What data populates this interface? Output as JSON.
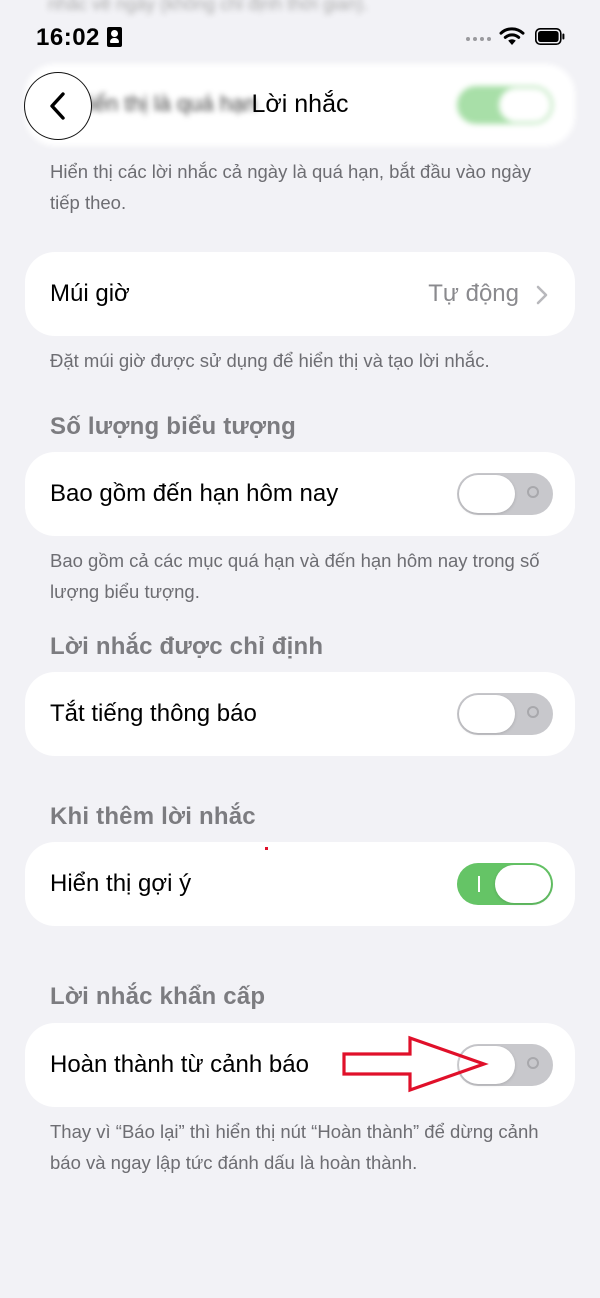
{
  "status_bar": {
    "time": "16:02"
  },
  "nav": {
    "title": "Lời nhắc",
    "back_icon": "chevron-left-icon"
  },
  "scrolled": {
    "top_text": "nhắc về ngày (không chỉ định thời gian).",
    "row_label": "Hiển thị là quá hạn"
  },
  "overdue_footnote": "Hiển thị các lời nhắc cả ngày là quá hạn, bắt đầu vào ngày tiếp theo.",
  "timezone": {
    "label": "Múi giờ",
    "value": "Tự động",
    "footnote": "Đặt múi giờ được sử dụng để hiển thị và tạo lời nhắc."
  },
  "badge_count": {
    "header": "Số lượng biểu tượng",
    "row_label": "Bao gồm đến hạn hôm nay",
    "enabled": false,
    "footnote": "Bao gồm cả các mục quá hạn và đến hạn hôm nay trong số lượng biểu tượng."
  },
  "assigned": {
    "header": "Lời nhắc được chỉ định",
    "row_label": "Tắt tiếng thông báo",
    "enabled": false
  },
  "when_adding": {
    "header": "Khi thêm lời nhắc",
    "row_label": "Hiển thị gợi ý",
    "enabled": true
  },
  "urgent": {
    "header": "Lời nhắc khẩn cấp",
    "row_label": "Hoàn thành từ cảnh báo",
    "enabled": false,
    "footnote": "Thay vì “Báo lại” thì hiển thị nút “Hoàn thành” để dừng cảnh báo và ngay lập tức đánh dấu là hoàn thành."
  },
  "colors": {
    "background": "#f2f2f6",
    "toggle_on": "#65c466",
    "toggle_off": "#c8c8cc",
    "annotation": "#e0102a"
  }
}
